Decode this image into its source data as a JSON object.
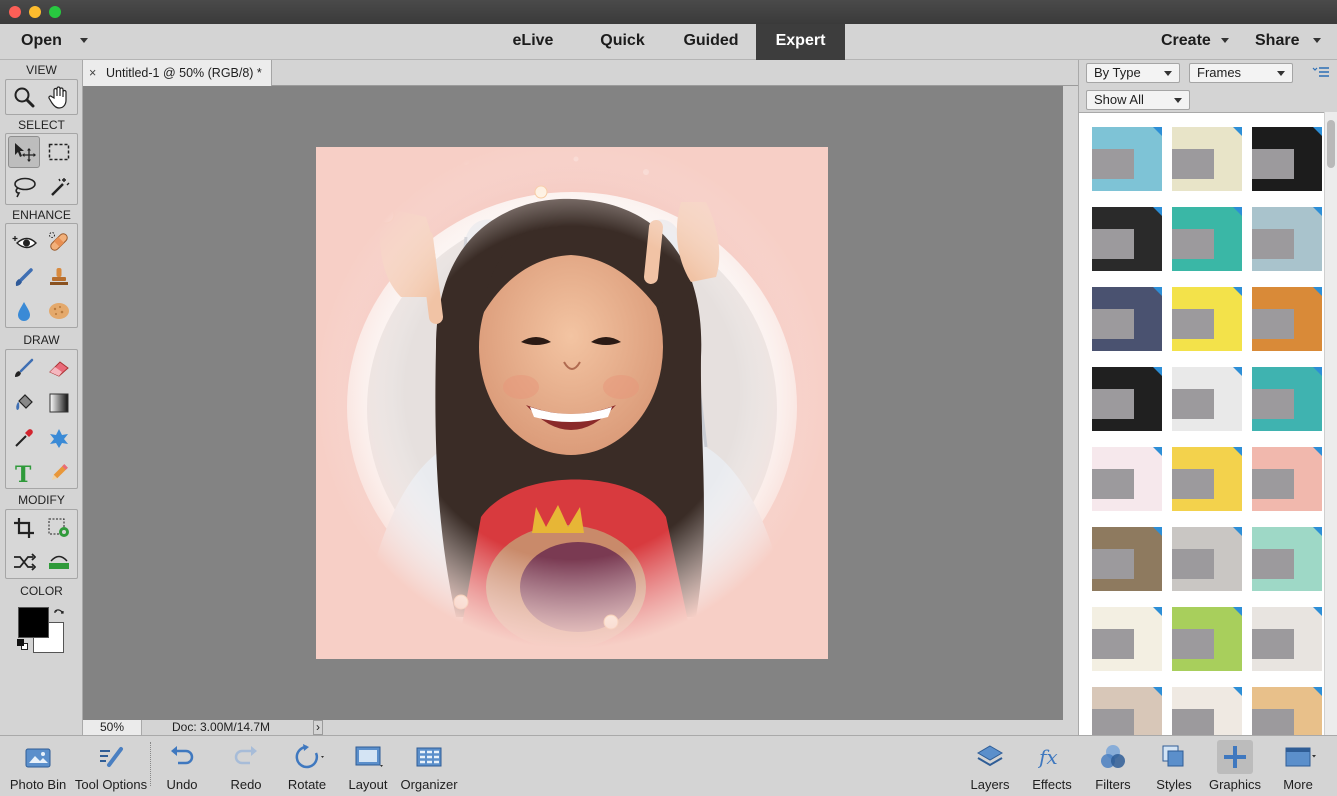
{
  "menubar": {
    "open_label": "Open",
    "modes": [
      "eLive",
      "Quick",
      "Guided",
      "Expert"
    ],
    "active_mode": "Expert",
    "create_label": "Create",
    "share_label": "Share"
  },
  "toolbox": {
    "view_label": "VIEW",
    "select_label": "SELECT",
    "enhance_label": "ENHANCE",
    "draw_label": "DRAW",
    "modify_label": "MODIFY",
    "color_label": "COLOR",
    "foreground_color": "#000000",
    "background_color": "#ffffff"
  },
  "document": {
    "tab_close": "×",
    "tab_title": "Untitled-1 @ 50% (RGB/8) *",
    "zoom": "50%",
    "doc_info": "Doc: 3.00M/14.7M",
    "status_arrow": "›"
  },
  "panel": {
    "filter_type": "By Type",
    "category": "Frames",
    "show_filter": "Show All",
    "thumbs": [
      [
        "#7ec3d6",
        "#e8e4c8",
        "#1c1c1c"
      ],
      [
        "#2a2a2a",
        "#3ab7a6",
        "#a9c3cc"
      ],
      [
        "#4a5270",
        "#f3e24a",
        "#d98a38"
      ],
      [
        "#202020",
        "#e9e9e9",
        "#3fb3b0"
      ],
      [
        "#f6e8ec",
        "#f3d24c",
        "#f1b8ad"
      ],
      [
        "#8e7a5f",
        "#c9c6c3",
        "#9ed8c6"
      ],
      [
        "#f3efe2",
        "#a8cf5c",
        "#e8e4e0"
      ],
      [
        "#d8c7b8",
        "#efe9e2",
        "#e8c08a"
      ]
    ]
  },
  "bottombar": {
    "photo_bin": "Photo Bin",
    "tool_options": "Tool Options",
    "undo": "Undo",
    "redo": "Redo",
    "rotate": "Rotate",
    "layout": "Layout",
    "organizer": "Organizer",
    "layers": "Layers",
    "effects": "Effects",
    "filters": "Filters",
    "styles": "Styles",
    "graphics": "Graphics",
    "more": "More"
  }
}
